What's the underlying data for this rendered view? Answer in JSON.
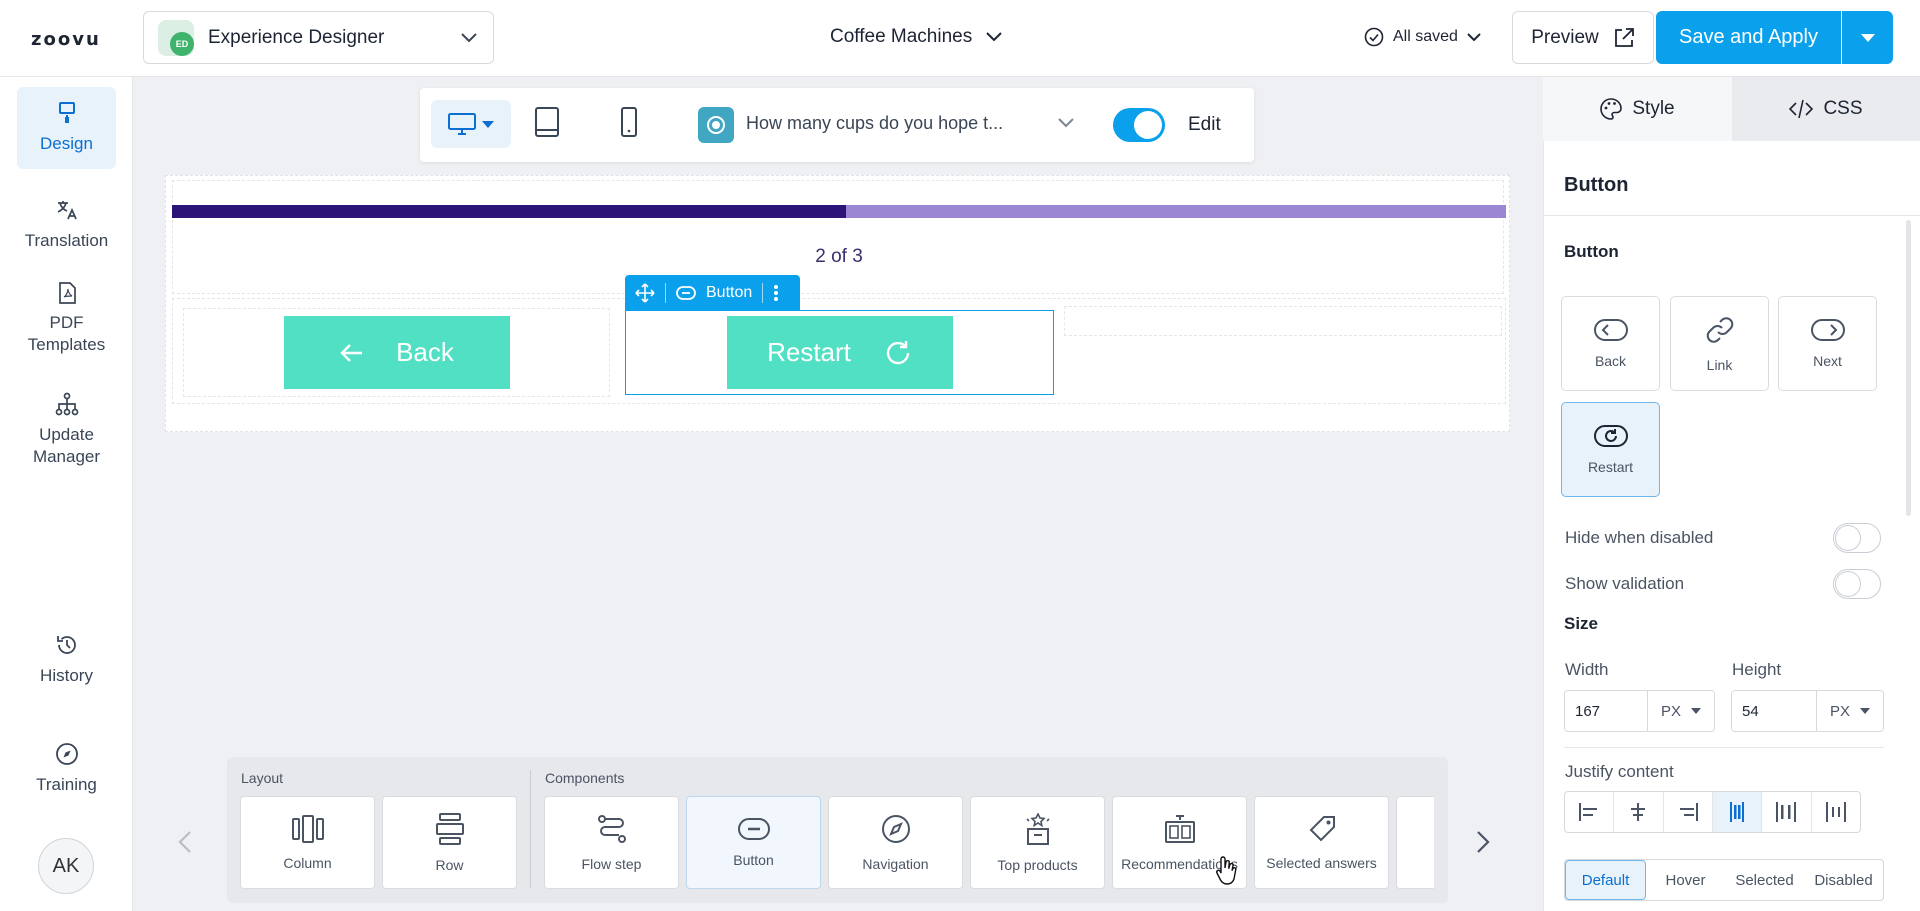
{
  "header": {
    "logo": "zoovu",
    "app_badge": "ED",
    "app_name": "Experience Designer",
    "project": "Coffee Machines",
    "saved_status": "All saved",
    "preview_label": "Preview",
    "save_label": "Save and Apply"
  },
  "leftnav": {
    "items": [
      {
        "label": "Design",
        "icon": "paint-roller-icon",
        "active": true
      },
      {
        "label": "Translation",
        "icon": "translate-icon"
      },
      {
        "label": "PDF Templates",
        "icon": "pdf-icon"
      },
      {
        "label": "Update Manager",
        "icon": "hierarchy-icon"
      }
    ],
    "bottom": [
      {
        "label": "History",
        "icon": "history-icon"
      },
      {
        "label": "Training",
        "icon": "compass-icon"
      }
    ],
    "avatar": "AK"
  },
  "toolbar": {
    "devices": [
      "desktop",
      "tablet",
      "mobile"
    ],
    "question": "How many cups do you hope t...",
    "edit_label": "Edit",
    "edit_on": true
  },
  "preview": {
    "progress_text": "2 of 3",
    "progress_fraction": 0.5,
    "back_label": "Back",
    "restart_label": "Restart",
    "selection_label": "Button",
    "colors": {
      "progress_fill": "#2b1378",
      "progress_track": "#9a86d3",
      "button": "#52e0c4",
      "accent": "#0aa0ec"
    }
  },
  "tray": {
    "layout_label": "Layout",
    "components_label": "Components",
    "layout_items": [
      {
        "label": "Column",
        "icon": "column-icon"
      },
      {
        "label": "Row",
        "icon": "row-icon"
      }
    ],
    "component_items": [
      {
        "label": "Flow step",
        "icon": "flow-icon"
      },
      {
        "label": "Button",
        "icon": "button-icon",
        "selected": true
      },
      {
        "label": "Navigation",
        "icon": "compass-icon"
      },
      {
        "label": "Top products",
        "icon": "top-products-icon"
      },
      {
        "label": "Recommendations",
        "icon": "recommendations-icon"
      },
      {
        "label": "Selected answers",
        "icon": "tag-icon"
      }
    ]
  },
  "panel": {
    "tabs": [
      "Style",
      "CSS"
    ],
    "title": "Button",
    "section_button": "Button",
    "types": [
      "Back",
      "Link",
      "Next",
      "Restart"
    ],
    "active_type": "Restart",
    "hide_when_disabled": "Hide when disabled",
    "show_validation": "Show validation",
    "size_title": "Size",
    "width_label": "Width",
    "width_value": "167",
    "width_unit": "PX",
    "height_label": "Height",
    "height_value": "54",
    "height_unit": "PX",
    "justify_label": "Justify content",
    "states": [
      "Default",
      "Hover",
      "Selected",
      "Disabled"
    ],
    "active_state": "Default"
  }
}
